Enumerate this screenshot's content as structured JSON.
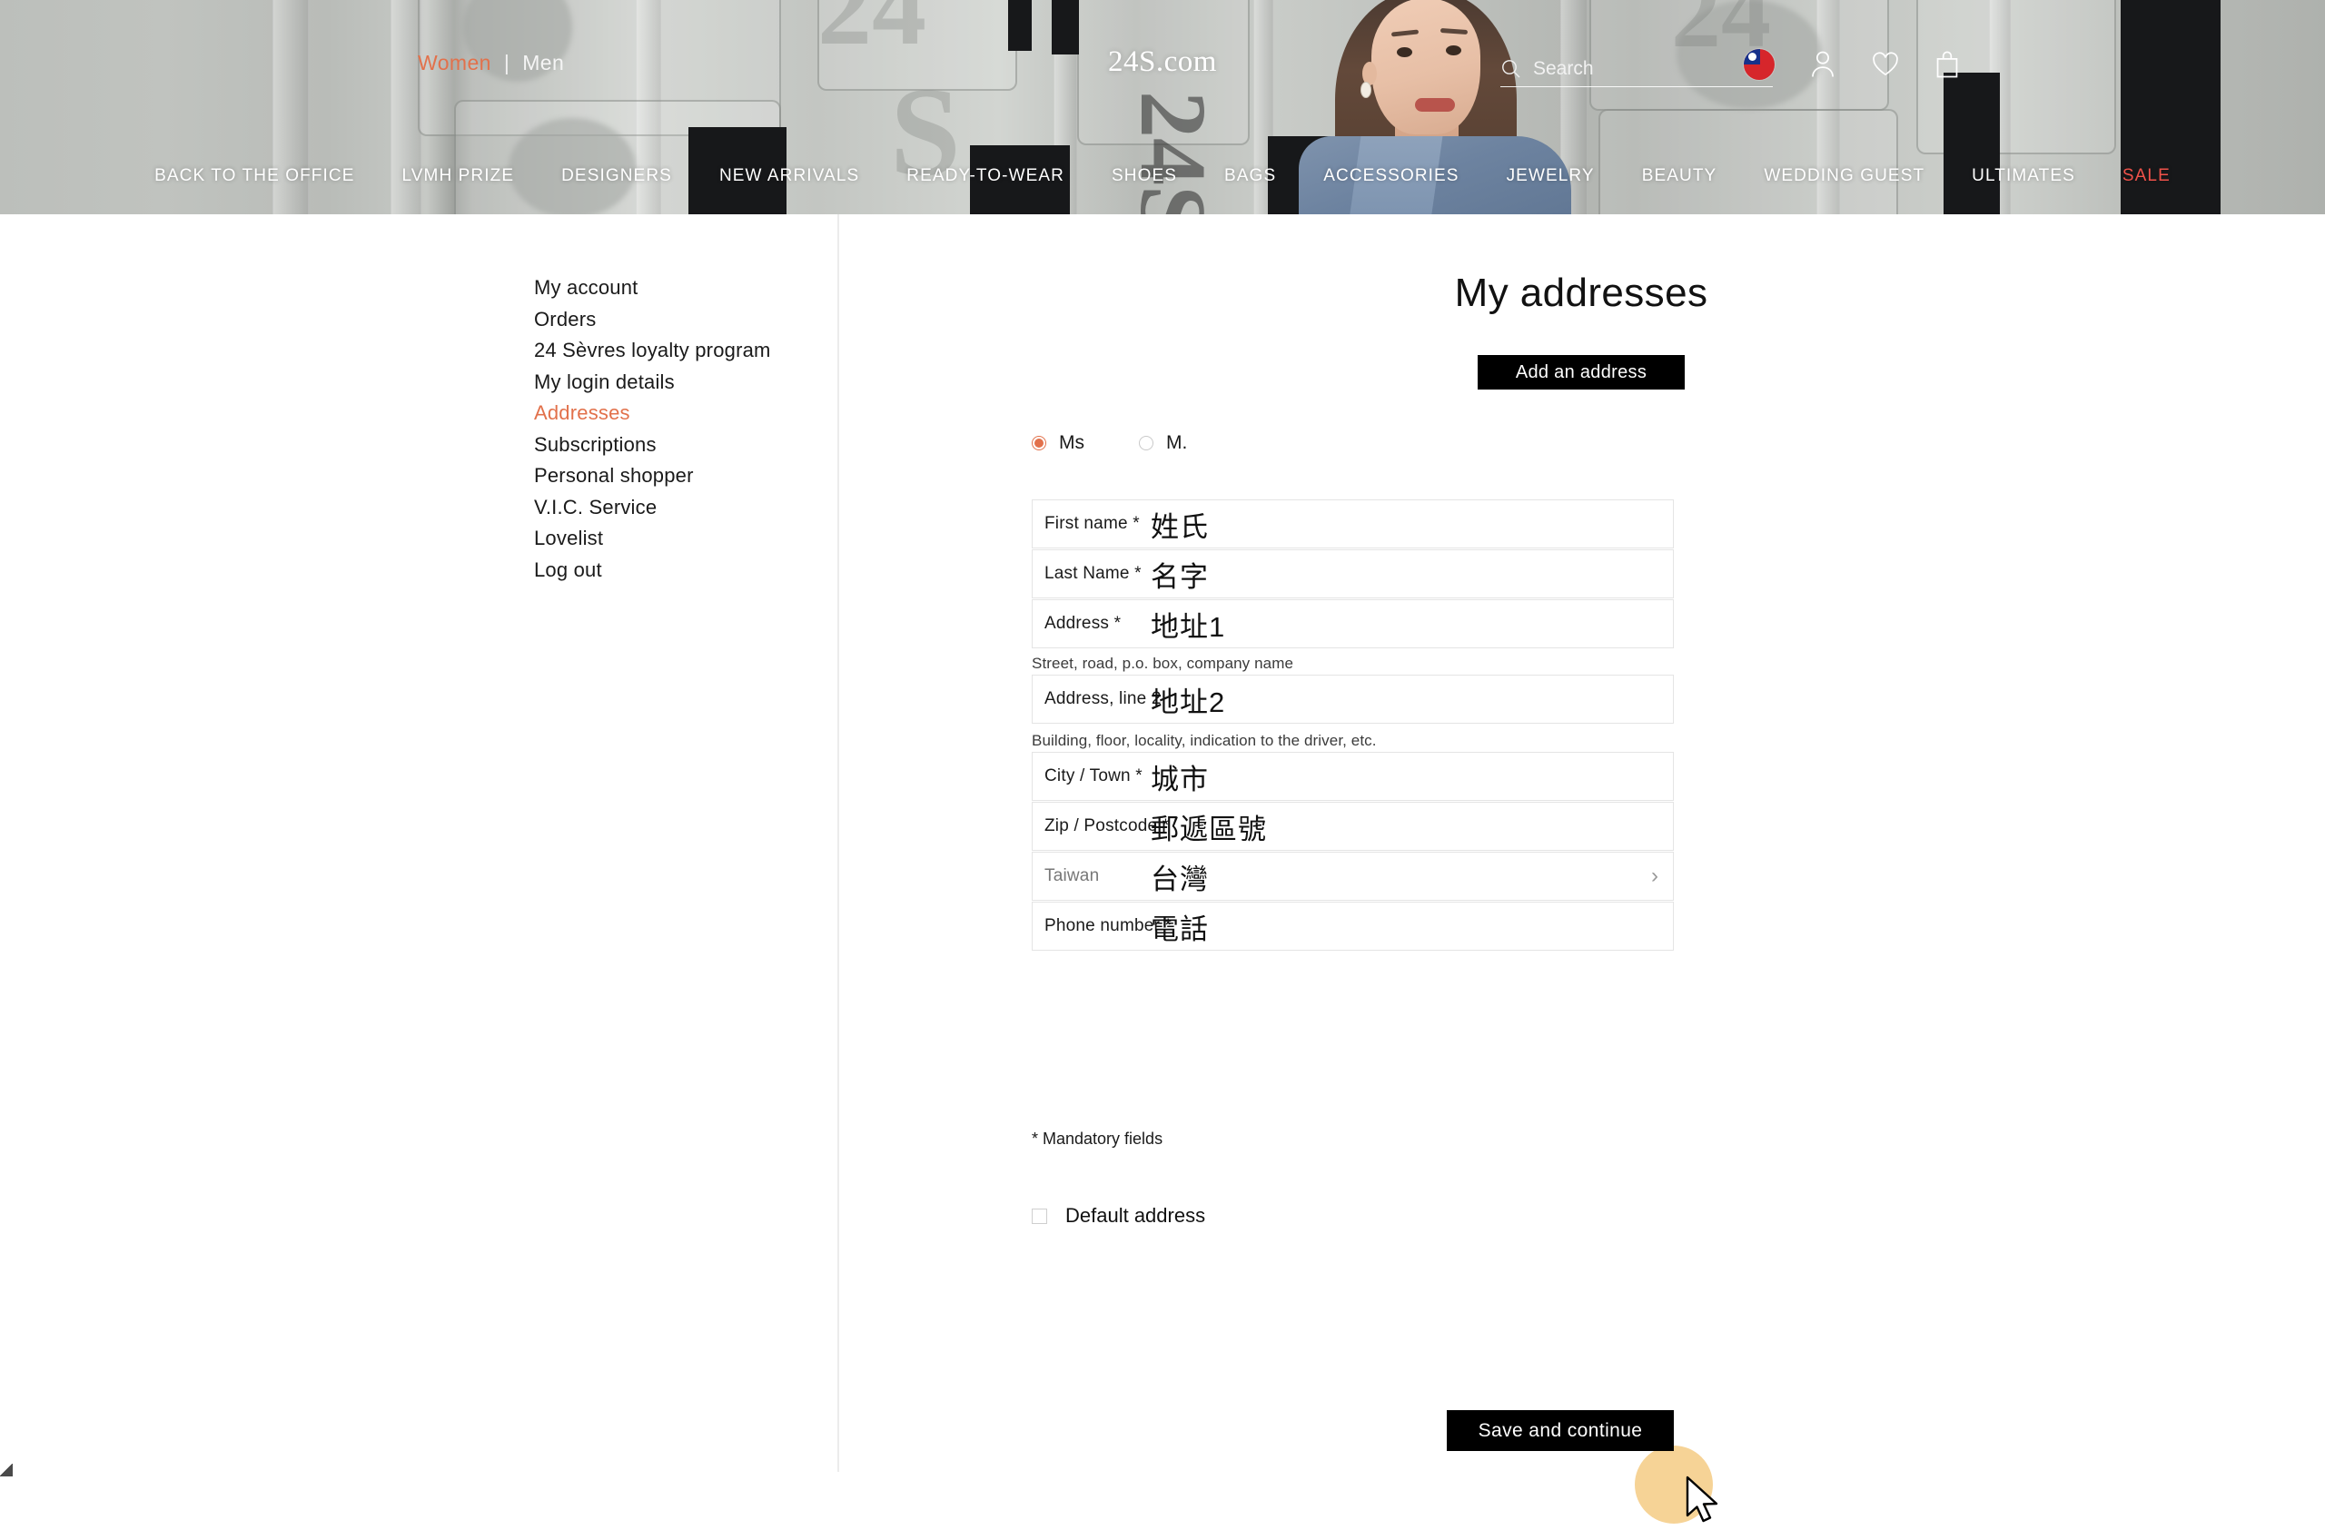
{
  "header": {
    "gender_switch": {
      "women": "Women",
      "separator": "|",
      "men": "Men"
    },
    "logo": "24S.com",
    "search_placeholder": "Search",
    "icons": {
      "search": "search-icon",
      "country_flag": "taiwan-flag-icon",
      "account": "user-icon",
      "wishlist": "heart-icon",
      "cart": "shopping-bag-icon"
    },
    "nav": [
      "BACK TO THE OFFICE",
      "LVMH PRIZE",
      "DESIGNERS",
      "NEW ARRIVALS",
      "READY-TO-WEAR",
      "SHOES",
      "BAGS",
      "ACCESSORIES",
      "JEWELRY",
      "BEAUTY",
      "WEDDING GUEST",
      "ULTIMATES",
      "SALE"
    ],
    "sale_label": "SALE"
  },
  "sidebar": {
    "items": [
      {
        "label": "My account",
        "active": false
      },
      {
        "label": "Orders",
        "active": false
      },
      {
        "label": "24 Sèvres loyalty program",
        "active": false
      },
      {
        "label": "My login details",
        "active": false
      },
      {
        "label": "Addresses",
        "active": true
      },
      {
        "label": "Subscriptions",
        "active": false
      },
      {
        "label": "Personal shopper",
        "active": false
      },
      {
        "label": "V.I.C. Service",
        "active": false
      },
      {
        "label": "Lovelist",
        "active": false
      },
      {
        "label": "Log out",
        "active": false
      }
    ]
  },
  "main": {
    "page_title": "My addresses",
    "add_address_button": "Add an address",
    "title_radio": {
      "ms": {
        "label": "Ms",
        "selected": true
      },
      "m": {
        "label": "M.",
        "selected": false
      }
    },
    "fields": [
      {
        "label": "First name *",
        "value": "姓氏"
      },
      {
        "label": "Last Name *",
        "value": "名字"
      },
      {
        "label": "Address *",
        "value": "地址1"
      },
      {
        "label": "Address, line 2",
        "value": "地址2"
      },
      {
        "label": "City / Town *",
        "value": "城市"
      },
      {
        "label": "Zip / Postcode *",
        "value": "郵遞區號"
      },
      {
        "label": "Taiwan",
        "value": "台灣"
      },
      {
        "label": "Phone number *",
        "value": "電話"
      }
    ],
    "hints": {
      "address": "Street, road, p.o. box, company name",
      "address2": "Building, floor, locality, indication to the driver, etc."
    },
    "mandatory_note": "* Mandatory fields",
    "default_address_label": "Default address",
    "default_address_checked": false,
    "save_button": "Save and continue",
    "country_chevron": "chevron-right-icon"
  },
  "colors": {
    "accent": "#e2714b",
    "sale": "#f0524a",
    "button_bg": "#000000",
    "field_border": "#e4e4e4",
    "click_highlight": "#f6cf8d"
  }
}
